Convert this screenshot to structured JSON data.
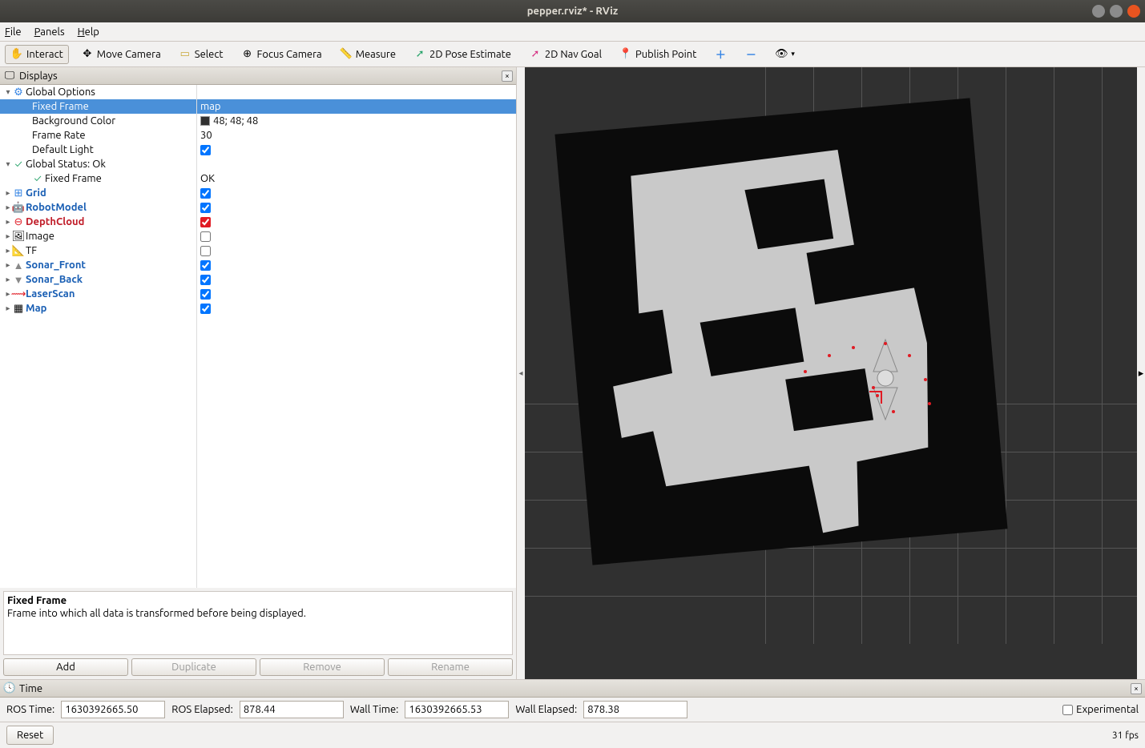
{
  "window": {
    "title": "pepper.rviz* - RViz"
  },
  "menu": {
    "file": "File",
    "panels": "Panels",
    "help": "Help"
  },
  "toolbar": {
    "interact": "Interact",
    "move_camera": "Move Camera",
    "select": "Select",
    "focus_camera": "Focus Camera",
    "measure": "Measure",
    "pose_estimate": "2D Pose Estimate",
    "nav_goal": "2D Nav Goal",
    "publish_point": "Publish Point"
  },
  "displays": {
    "title": "Displays",
    "tree": {
      "global_options": "Global Options",
      "fixed_frame": {
        "label": "Fixed Frame",
        "value": "map"
      },
      "background_color": {
        "label": "Background Color",
        "value": "48; 48; 48"
      },
      "frame_rate": {
        "label": "Frame Rate",
        "value": "30"
      },
      "default_light": {
        "label": "Default Light",
        "checked": true
      },
      "global_status": "Global Status: Ok",
      "status_fixed_frame": {
        "label": "Fixed Frame",
        "value": "OK"
      },
      "grid": {
        "label": "Grid",
        "checked": true
      },
      "robotmodel": {
        "label": "RobotModel",
        "checked": true
      },
      "depthcloud": {
        "label": "DepthCloud",
        "checked": true
      },
      "image": {
        "label": "Image",
        "checked": false
      },
      "tf": {
        "label": "TF",
        "checked": false
      },
      "sonar_front": {
        "label": "Sonar_Front",
        "checked": true
      },
      "sonar_back": {
        "label": "Sonar_Back",
        "checked": true
      },
      "laserscan": {
        "label": "LaserScan",
        "checked": true
      },
      "map": {
        "label": "Map",
        "checked": true
      }
    },
    "desc": {
      "title": "Fixed Frame",
      "body": "Frame into which all data is transformed before being displayed."
    },
    "buttons": {
      "add": "Add",
      "duplicate": "Duplicate",
      "remove": "Remove",
      "rename": "Rename"
    }
  },
  "time_panel": {
    "title": "Time",
    "ros_time_label": "ROS Time:",
    "ros_time": "1630392665.50",
    "ros_elapsed_label": "ROS Elapsed:",
    "ros_elapsed": "878.44",
    "wall_time_label": "Wall Time:",
    "wall_time": "1630392665.53",
    "wall_elapsed_label": "Wall Elapsed:",
    "wall_elapsed": "878.38",
    "experimental": "Experimental"
  },
  "footer": {
    "reset": "Reset",
    "fps": "31 fps"
  },
  "colors": {
    "bg3d": "#303030",
    "map_dark": "#0b0b0b",
    "floor": "#c9c9c9"
  }
}
